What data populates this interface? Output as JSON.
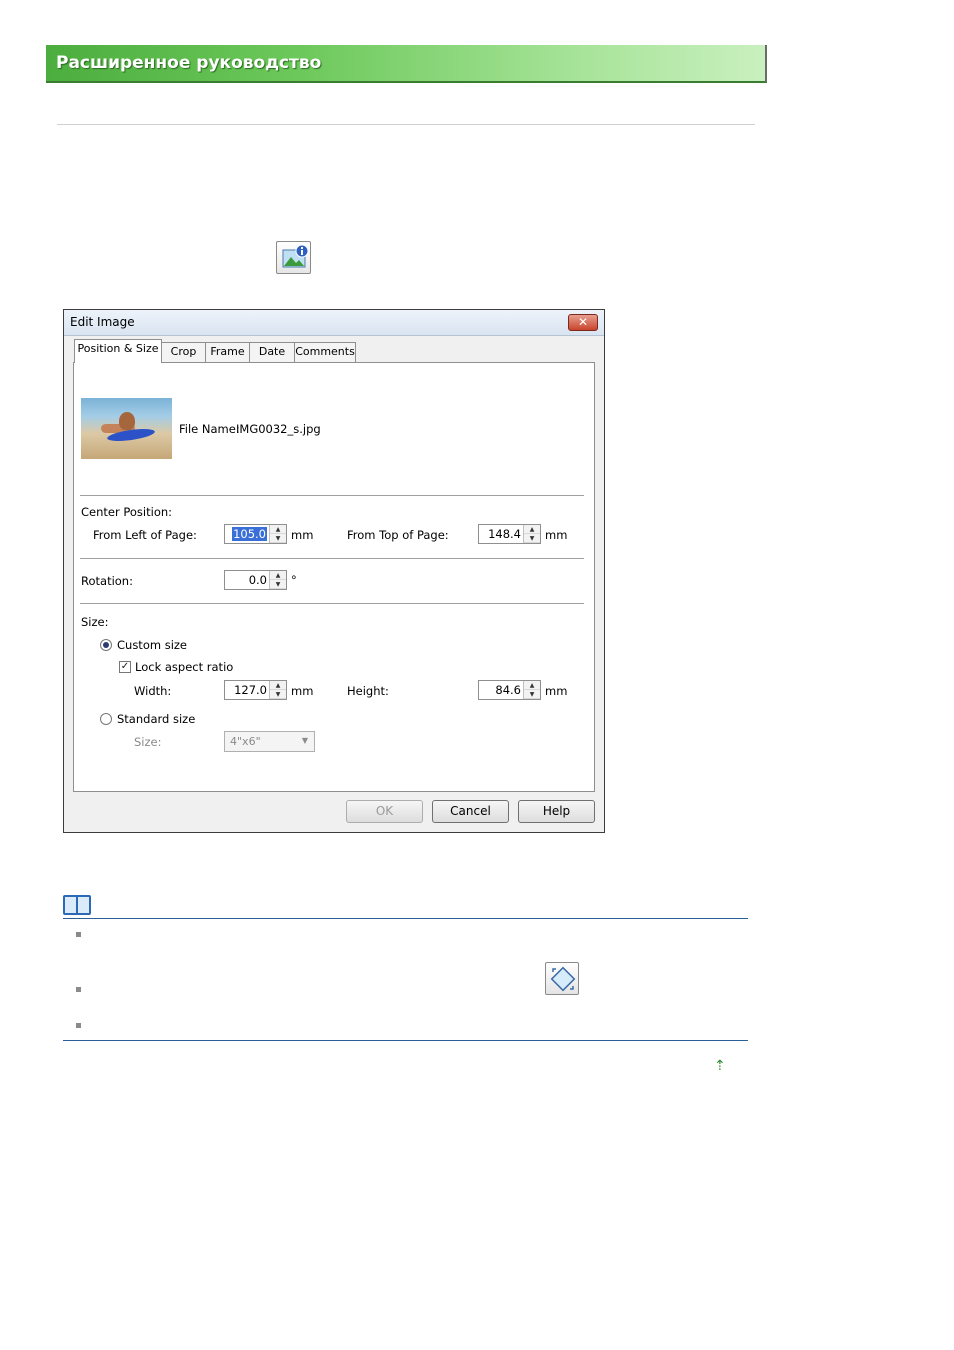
{
  "banner": {
    "title": "Расширенное руководство"
  },
  "dialog": {
    "title": "Edit Image",
    "close_glyph": "✕",
    "tabs": [
      "Position & Size",
      "Crop",
      "Frame",
      "Date",
      "Comments"
    ],
    "file_name_label": "File Name:",
    "file_name": "IMG0032_s.jpg",
    "center_position": {
      "heading": "Center Position:",
      "from_left_label": "From Left of Page:",
      "from_left_value": "105.0",
      "from_left_unit": "mm",
      "from_top_label": "From Top of Page:",
      "from_top_value": "148.4",
      "from_top_unit": "mm"
    },
    "rotation": {
      "label": "Rotation:",
      "value": "0.0",
      "unit": "°"
    },
    "size": {
      "heading": "Size:",
      "custom_size_label": "Custom size",
      "custom_size_selected": true,
      "lock_aspect_label": "Lock aspect ratio",
      "lock_aspect_checked": true,
      "width_label": "Width:",
      "width_value": "127.0",
      "width_unit": "mm",
      "height_label": "Height:",
      "height_value": "84.6",
      "height_unit": "mm",
      "standard_size_label": "Standard size",
      "standard_size_selected": false,
      "size_label": "Size:",
      "size_value": "4\"x6\""
    },
    "buttons": {
      "ok": "OK",
      "cancel": "Cancel",
      "help": "Help"
    }
  },
  "icons": {
    "image_info": "image-info-icon",
    "note": "note-book-icon",
    "fit_to_frame": "fit-to-frame-icon",
    "back_to_top": "arrow-up-icon"
  },
  "colors": {
    "banner_green": "#5cbd4c",
    "note_rule": "#2a5f98",
    "selection": "#3a6fd8"
  }
}
